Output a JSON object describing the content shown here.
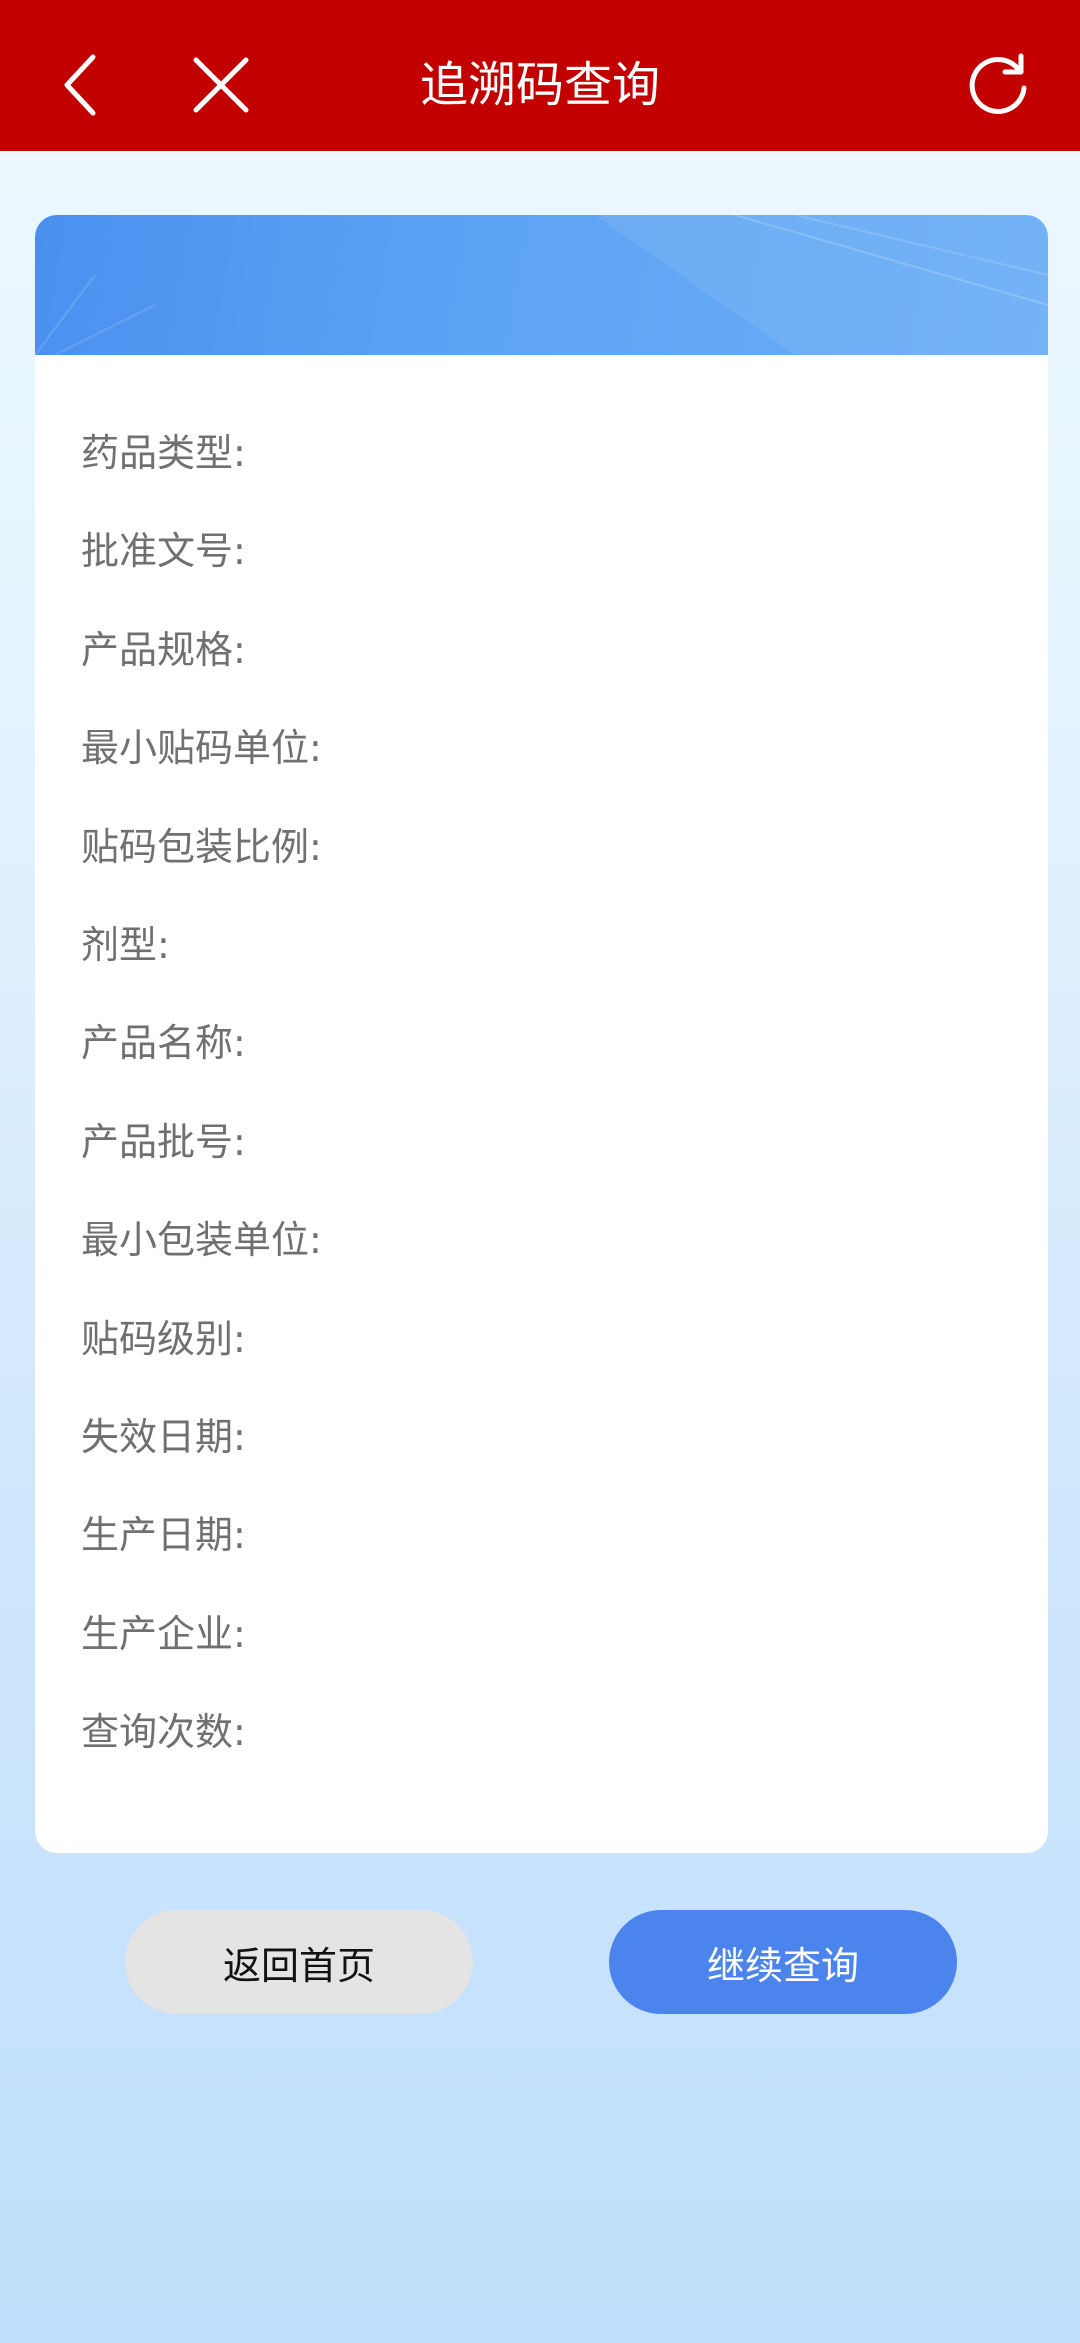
{
  "header": {
    "title": "追溯码查询",
    "back_icon": "chevron-left-icon",
    "close_icon": "close-icon",
    "refresh_icon": "refresh-icon",
    "bg_color": "#c30000"
  },
  "card": {
    "colon": ":",
    "fields": [
      {
        "label": "药品类型",
        "value": ""
      },
      {
        "label": "批准文号",
        "value": ""
      },
      {
        "label": "产品规格",
        "value": ""
      },
      {
        "label": "最小贴码单位",
        "value": ""
      },
      {
        "label": "贴码包装比例",
        "value": ""
      },
      {
        "label": "剂型",
        "value": ""
      },
      {
        "label": "产品名称",
        "value": ""
      },
      {
        "label": "产品批号",
        "value": ""
      },
      {
        "label": "最小包装单位",
        "value": ""
      },
      {
        "label": "贴码级别",
        "value": ""
      },
      {
        "label": "失效日期",
        "value": ""
      },
      {
        "label": "生产日期",
        "value": ""
      },
      {
        "label": "生产企业",
        "value": ""
      },
      {
        "label": "查询次数",
        "value": ""
      }
    ]
  },
  "buttons": {
    "home_label": "返回首页",
    "continue_label": "继续查询",
    "accent_color": "#4b84ec"
  }
}
